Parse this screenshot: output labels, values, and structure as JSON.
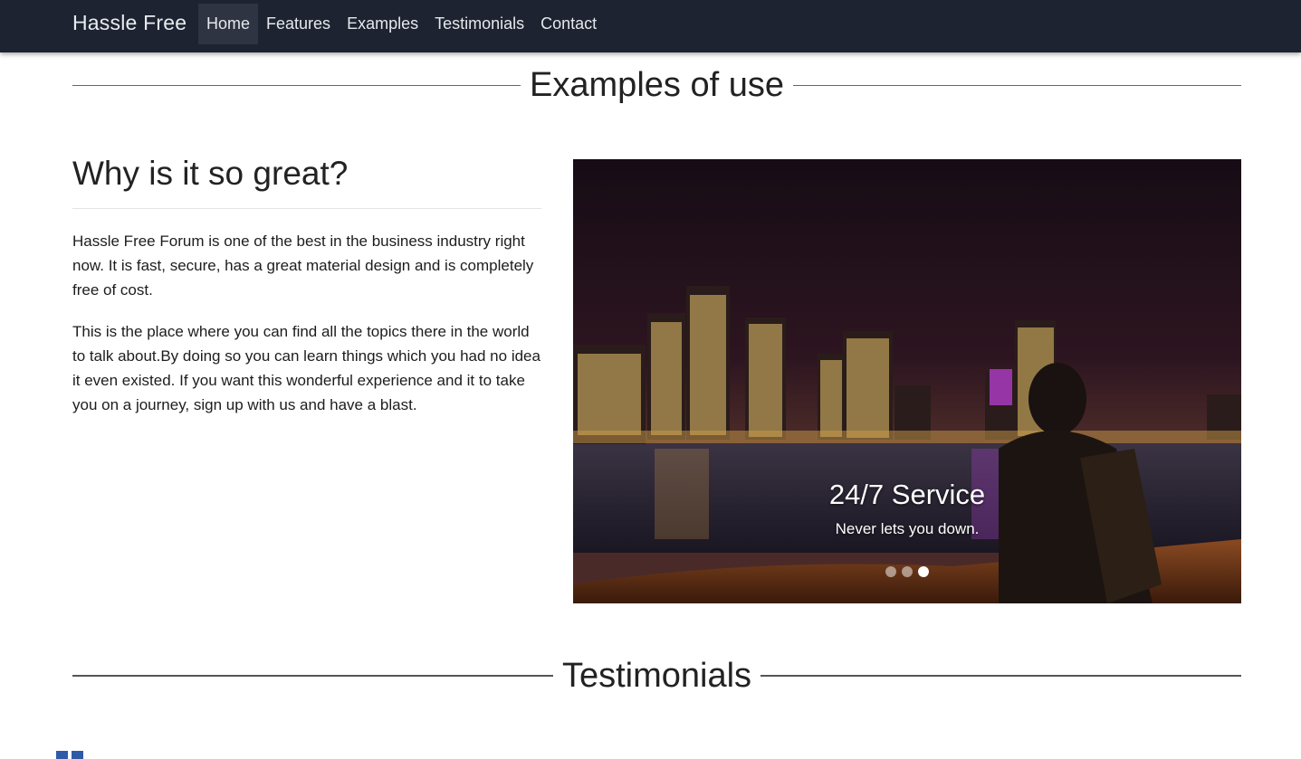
{
  "navbar": {
    "brand": "Hassle Free",
    "items": [
      {
        "label": "Home",
        "active": true
      },
      {
        "label": "Features"
      },
      {
        "label": "Examples"
      },
      {
        "label": "Testimonials"
      },
      {
        "label": "Contact"
      }
    ],
    "bg_color": "#1d2330"
  },
  "examples_section": {
    "title": "Examples of use"
  },
  "why_section": {
    "heading": "Why is it so great?",
    "paragraphs": [
      "Hassle Free Forum is one of the best in the business industry right now. It is fast, secure, has a great material design and is completely free of cost.",
      "This is the place where you can find all the topics there in the world to talk about.By doing so you can learn things which you had no idea it even existed. If you want this wonderful experience and it to take you on a journey, sign up with us and have a blast."
    ]
  },
  "carousel": {
    "caption_title": "24/7 Service",
    "caption_text": "Never lets you down.",
    "slide_count": 3,
    "active_slide": 3,
    "image": "night-city-skyline-river-man-with-backpack"
  },
  "testimonials_section": {
    "title": "Testimonials"
  }
}
